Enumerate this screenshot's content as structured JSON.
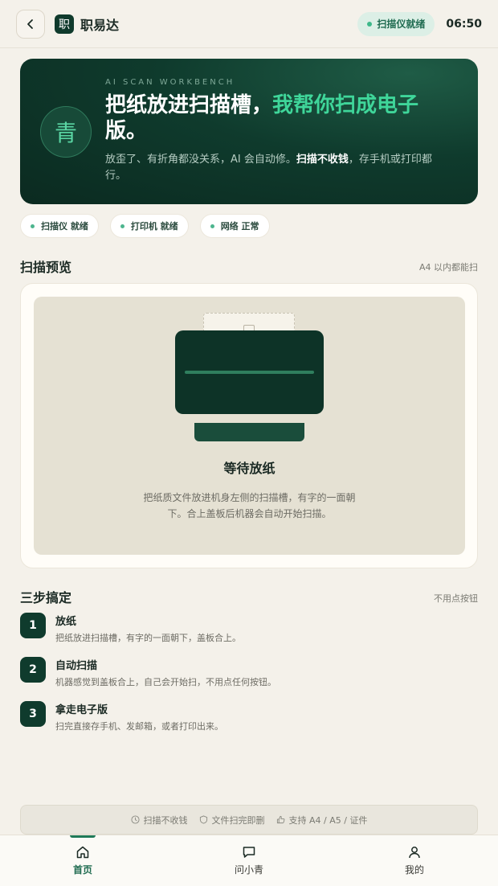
{
  "header": {
    "app_name": "职易达",
    "logo_char": "职",
    "status": "扫描仪就绪",
    "time": "06:50",
    "icons": {
      "back": "chevron-left-icon"
    }
  },
  "hero": {
    "avatar_char": "青",
    "eyebrow": "AI SCAN WORKBENCH",
    "title_plain": "把纸放进扫描槽，",
    "title_highlight": "我帮你扫成电子",
    "title_end": "版。",
    "desc_before": "放歪了、有折角都没关系，AI 会自动修。",
    "desc_bold": "扫描不收钱",
    "desc_after": "，存手机或打印都行。"
  },
  "chips": [
    {
      "label": "扫描仪 就绪"
    },
    {
      "label": "打印机 就绪"
    },
    {
      "label": "网络 正常"
    }
  ],
  "preview": {
    "section_title": "扫描预览",
    "section_note": "A4 以内都能扫",
    "waiting_title": "等待放纸",
    "waiting_desc": "把纸质文件放进机身左侧的扫描槽，有字的一面朝下。合上盖板后机器会自动开始扫描。"
  },
  "steps": {
    "section_title": "三步搞定",
    "section_note": "不用点按钮",
    "items": [
      {
        "num": "1",
        "title": "放纸",
        "desc": "把纸放进扫描槽，有字的一面朝下，盖板合上。"
      },
      {
        "num": "2",
        "title": "自动扫描",
        "desc": "机器感觉到盖板合上，自己会开始扫，不用点任何按钮。"
      },
      {
        "num": "3",
        "title": "拿走电子版",
        "desc": "扫完直接存手机、发邮箱，或者打印出来。"
      }
    ]
  },
  "trust": [
    {
      "icon": "clock-icon",
      "label": "扫描不收钱"
    },
    {
      "icon": "shield-icon",
      "label": "文件扫完即删"
    },
    {
      "icon": "thumbs-up-icon",
      "label": "支持 A4 / A5 / 证件"
    }
  ],
  "nav": [
    {
      "label": "首页",
      "icon": "home-icon",
      "active": true
    },
    {
      "label": "问小青",
      "icon": "chat-icon",
      "active": false
    },
    {
      "label": "我的",
      "icon": "user-icon",
      "active": false
    }
  ],
  "colors": {
    "accent": "#3fd69a",
    "dark_green": "#0f3b2d",
    "background": "#f4f1ea"
  }
}
